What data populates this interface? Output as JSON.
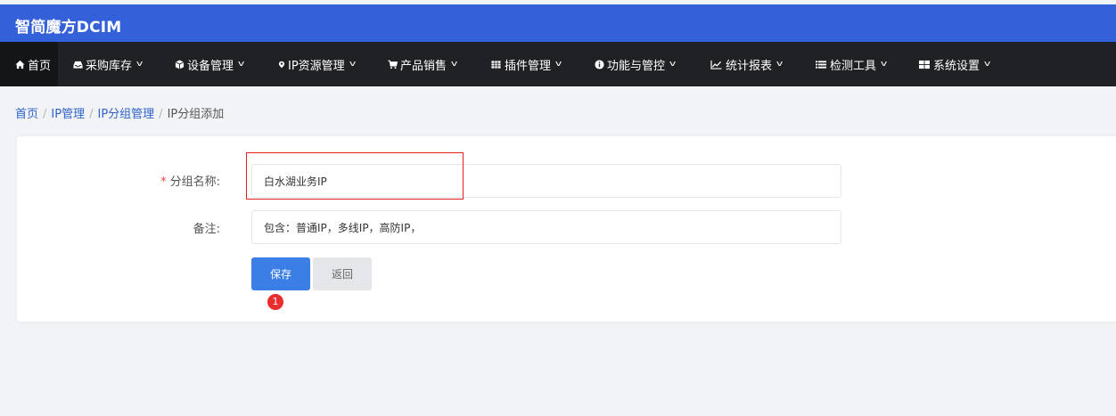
{
  "app": {
    "title": "智简魔方DCIM"
  },
  "nav": {
    "items": [
      {
        "label": "首页",
        "icon": "home-icon",
        "caret": false
      },
      {
        "label": "采购库存",
        "icon": "inbox-icon",
        "caret": true
      },
      {
        "label": "设备管理",
        "icon": "cube-icon",
        "caret": true
      },
      {
        "label": "IP资源管理",
        "icon": "map-marker-icon",
        "caret": true
      },
      {
        "label": "产品销售",
        "icon": "cart-icon",
        "caret": true
      },
      {
        "label": "插件管理",
        "icon": "table-icon",
        "caret": true
      },
      {
        "label": "功能与管控",
        "icon": "info-circle-icon",
        "caret": true
      },
      {
        "label": "统计报表",
        "icon": "line-chart-icon",
        "caret": true
      },
      {
        "label": "检测工具",
        "icon": "list-icon",
        "caret": true
      },
      {
        "label": "系统设置",
        "icon": "grid-icon",
        "caret": true
      }
    ],
    "caret_glyph": "v"
  },
  "breadcrumb": {
    "items": [
      "首页",
      "IP管理",
      "IP分组管理",
      "IP分组添加"
    ],
    "separator": "/"
  },
  "form": {
    "name_label": "分组名称:",
    "required_mark": "*",
    "name_value": "白水湖业务IP",
    "remark_label": "备注:",
    "remark_value": "包含：普通IP，多线IP，高防IP，"
  },
  "buttons": {
    "save": "保存",
    "back": "返回"
  },
  "annotation": {
    "badge": "1"
  },
  "colors": {
    "topbar": "#3461d9",
    "navbar": "#202124",
    "primary_button": "#3a7ee6",
    "highlight_box": "#e02020",
    "badge": "#ea2d2d",
    "link": "#2f63c9"
  }
}
